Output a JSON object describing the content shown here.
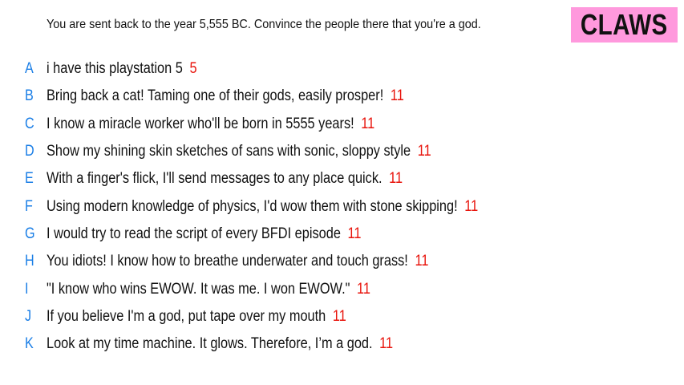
{
  "prompt": "You are sent back to the year 5,555 BC. Convince the people there that you're a god.",
  "team": "CLAWS",
  "colors": {
    "letter": "#1a7ee6",
    "score": "#e8140c",
    "badge": "#ff99dd"
  },
  "answers": [
    {
      "letter": "A",
      "text": "i have this playstation 5",
      "score": "5"
    },
    {
      "letter": "B",
      "text": "Bring back a cat! Taming one of their gods, easily prosper!",
      "score": "11"
    },
    {
      "letter": "C",
      "text": "I know a miracle worker who'll be born in 5555 years!",
      "score": "11"
    },
    {
      "letter": "D",
      "text": "Show my shining skin sketches of sans with sonic, sloppy style",
      "score": "11"
    },
    {
      "letter": "E",
      "text": "With a finger's flick, I'll send messages to any place quick.",
      "score": "11"
    },
    {
      "letter": "F",
      "text": "Using modern knowledge of physics, I'd wow them with stone skipping!",
      "score": "11"
    },
    {
      "letter": "G",
      "text": "I would try to read the script of every BFDI episode",
      "score": "11"
    },
    {
      "letter": "H",
      "text": "You idiots! I know how to breathe underwater and touch grass!",
      "score": "11"
    },
    {
      "letter": "I",
      "text": "\"I know who wins EWOW. It was me. I won EWOW.\"",
      "score": "11"
    },
    {
      "letter": "J",
      "text": "If you believe I'm a god, put tape over my mouth",
      "score": "11"
    },
    {
      "letter": "K",
      "text": "Look at my time machine. It glows. Therefore, I’m a god.",
      "score": "11"
    }
  ]
}
